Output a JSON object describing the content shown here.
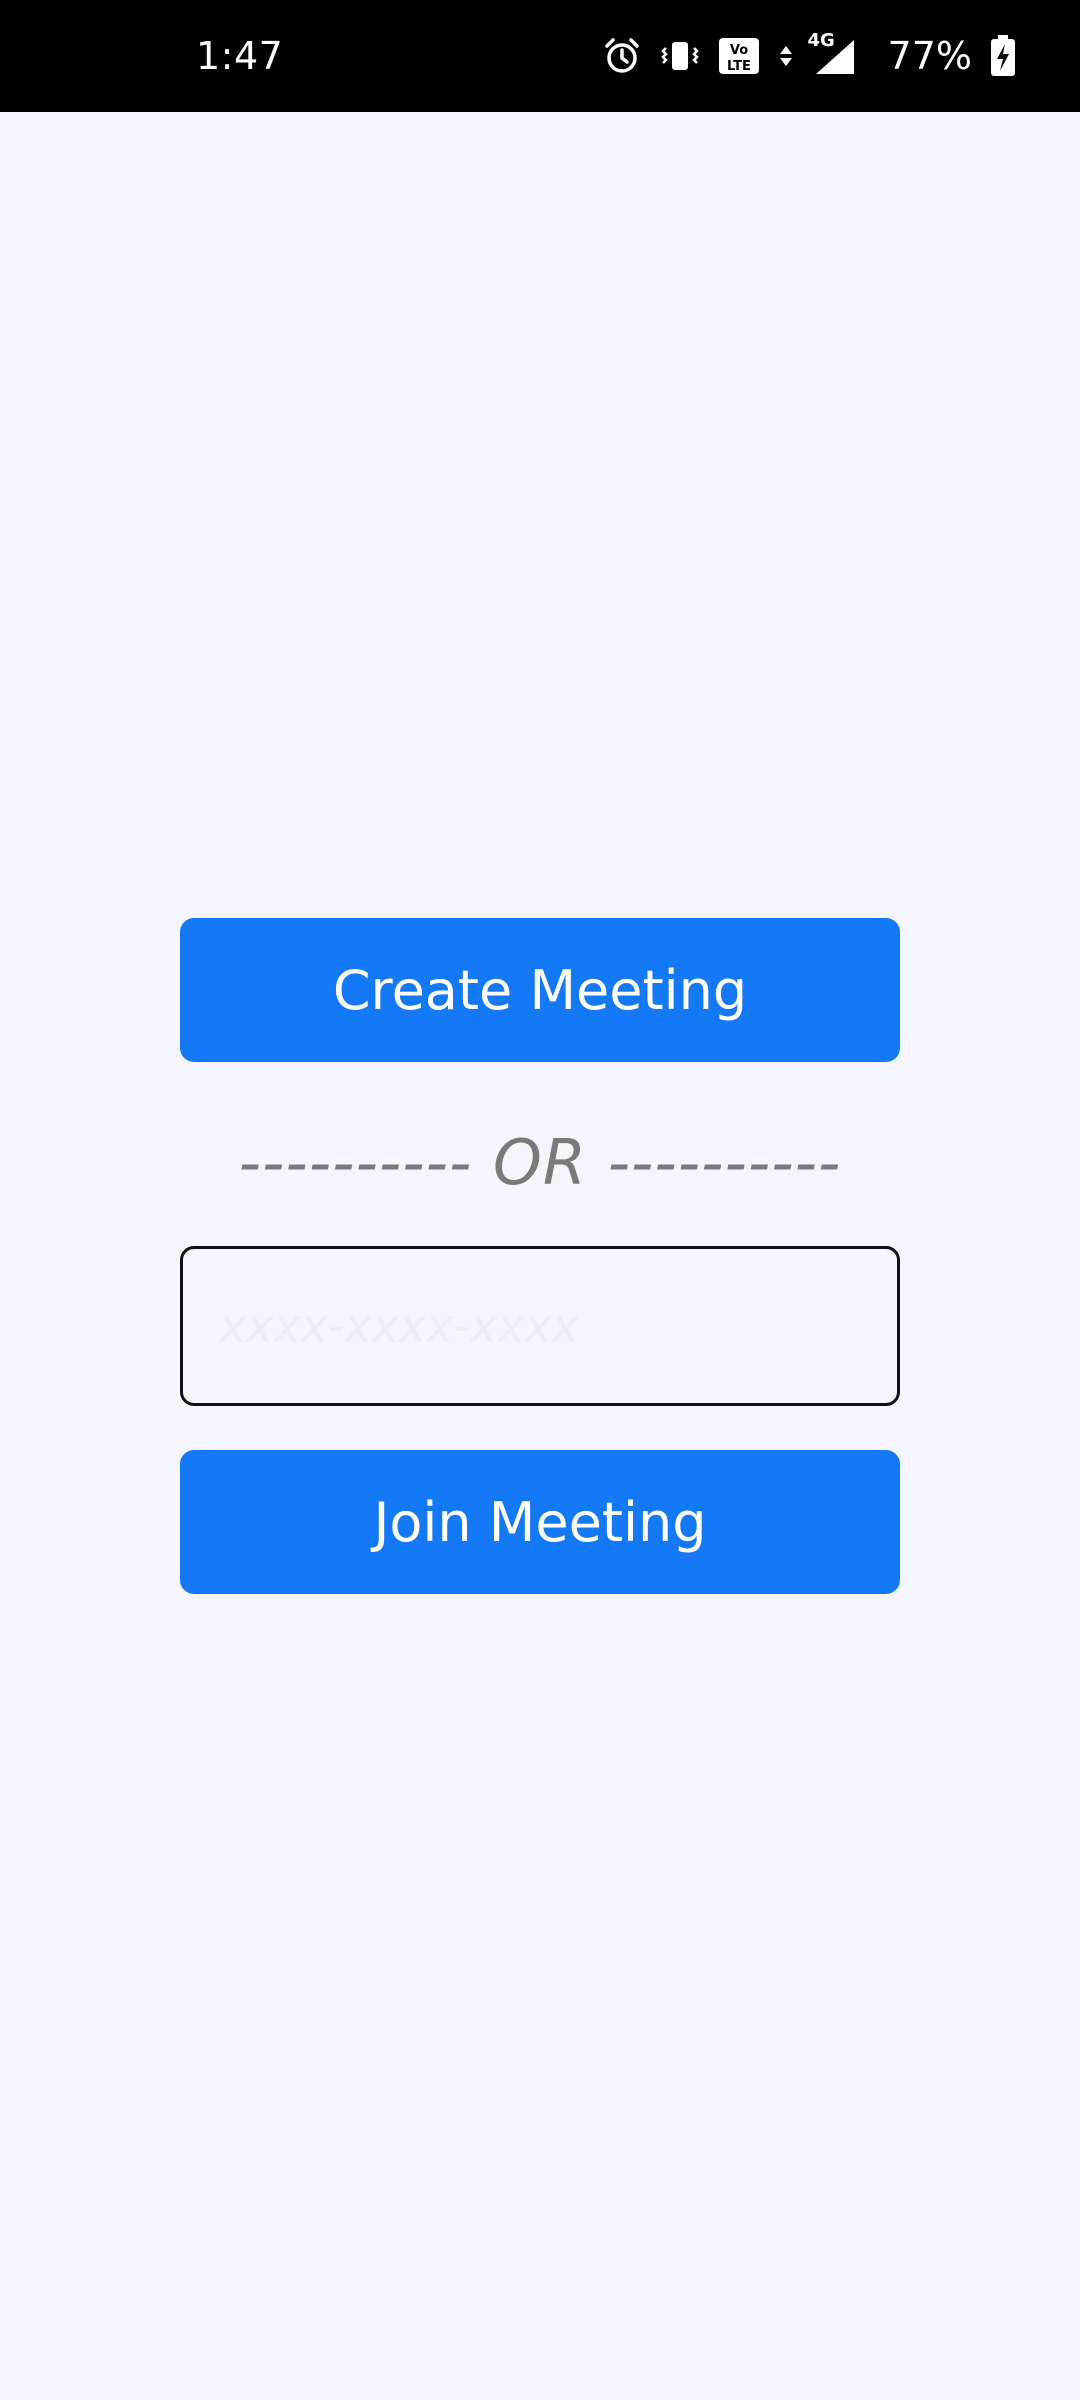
{
  "status_bar": {
    "time": "1:47",
    "network_label": "4G",
    "battery_percent": "77%",
    "icons": [
      "alarm-icon",
      "vibrate-icon",
      "volte-icon",
      "data-arrows-icon",
      "signal-icon",
      "battery-charging-icon"
    ]
  },
  "meeting": {
    "create_label": "Create Meeting",
    "or_label": "---------- OR ----------",
    "input_placeholder": "xxxx-xxxx-xxxx",
    "input_value": "",
    "join_label": "Join Meeting"
  },
  "colors": {
    "accent": "#1479F6",
    "background": "#F4F5FD",
    "status_bar": "#000000",
    "divider_text": "#7A7A7A"
  }
}
